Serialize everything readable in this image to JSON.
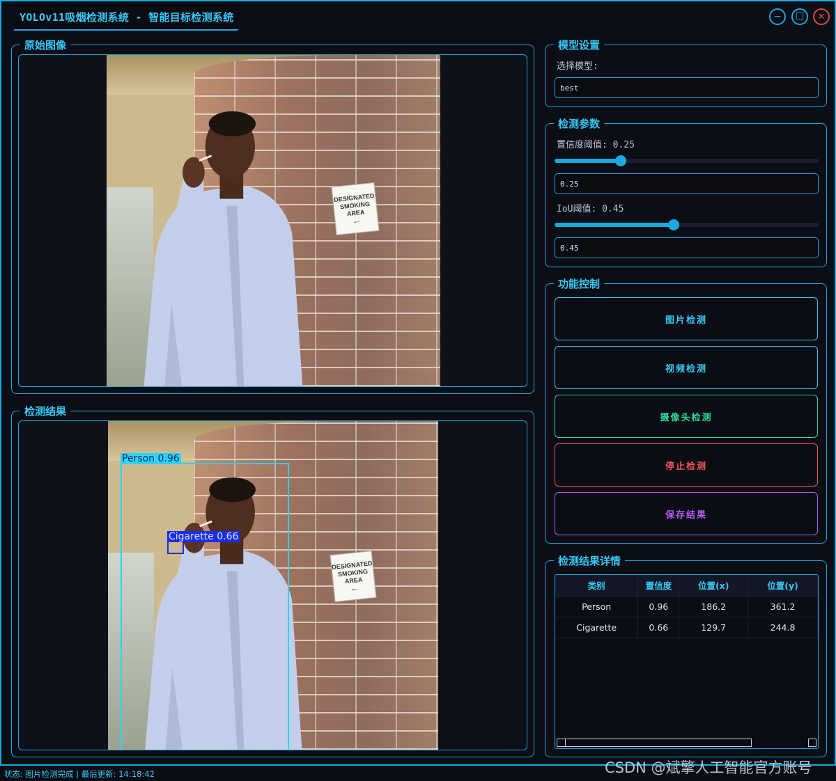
{
  "window": {
    "title": "YOLOv11吸烟检测系统 - 智能目标检测系统",
    "minimize_glyph": "−",
    "maximize_glyph": "☐",
    "close_glyph": "✕"
  },
  "original_panel": {
    "title": "原始图像",
    "sign_lines": [
      "DESIGNATED",
      "SMOKING",
      "AREA"
    ]
  },
  "result_panel": {
    "title": "检测结果",
    "detections": [
      {
        "label": "Person 0.96",
        "class": "Person",
        "color": "#2bd3f5"
      },
      {
        "label": "Cigarette 0.66",
        "class": "Cigarette",
        "color": "#1a2de8"
      }
    ]
  },
  "model_settings": {
    "title": "模型设置",
    "select_label": "选择模型:",
    "model_value": "best"
  },
  "detect_params": {
    "title": "检测参数",
    "confidence": {
      "label": "置信度阈值: 0.25",
      "input_value": "0.25",
      "value": 0.25,
      "max": 1.0
    },
    "iou": {
      "label": "IoU阈值: 0.45",
      "input_value": "0.45",
      "value": 0.45,
      "max": 1.0
    }
  },
  "controls": {
    "title": "功能控制",
    "buttons": [
      {
        "label": "图片检测",
        "color": "#36c8f5"
      },
      {
        "label": "视频检测",
        "color": "#36c8f5"
      },
      {
        "label": "摄像头检测",
        "color": "#2bd9a0"
      },
      {
        "label": "停止检测",
        "color": "#f05555"
      },
      {
        "label": "保存结果",
        "color": "#b45cf0"
      }
    ]
  },
  "details": {
    "title": "检测结果详情",
    "columns": [
      "类别",
      "置信度",
      "位置(x)",
      "位置(y)"
    ],
    "rows": [
      [
        "Person",
        "0.96",
        "186.2",
        "361.2"
      ],
      [
        "Cigarette",
        "0.66",
        "129.7",
        "244.8"
      ]
    ]
  },
  "status": {
    "text": "状态: 图片检测完成 | 最后更新: 14:18:42"
  },
  "watermark": "CSDN @斌擎人工智能官方账号",
  "colors": {
    "accent": "#1aa9e0",
    "title_text": "#36c8f5",
    "background": "#0c0e16"
  }
}
